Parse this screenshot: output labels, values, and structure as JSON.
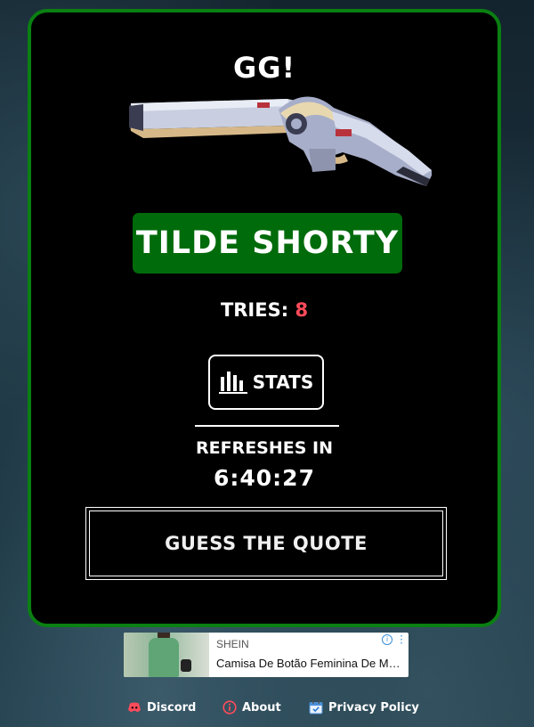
{
  "result": {
    "heading": "GG!",
    "weapon_name": "TILDE SHORTY",
    "tries_label": "TRIES: ",
    "tries_value": "8"
  },
  "stats_button": {
    "label": "STATS"
  },
  "refresh": {
    "label": "REFRESHES IN",
    "countdown": "6:40:27"
  },
  "next_mode_button": {
    "label": "GUESS THE QUOTE"
  },
  "ad": {
    "brand": "SHEIN",
    "title": "Camisa De Botão Feminina De Manga Longa",
    "info_glyph": "i"
  },
  "footer": {
    "links": [
      {
        "label": "Discord",
        "icon": "discord-icon"
      },
      {
        "label": "About",
        "icon": "info-icon"
      },
      {
        "label": "Privacy Policy",
        "icon": "calendar-check-icon"
      }
    ]
  },
  "colors": {
    "card_border": "#0a7f12",
    "name_badge_bg": "#006b0b",
    "tries_value": "#ff4b5a",
    "accent_red": "#ff4b5a"
  }
}
